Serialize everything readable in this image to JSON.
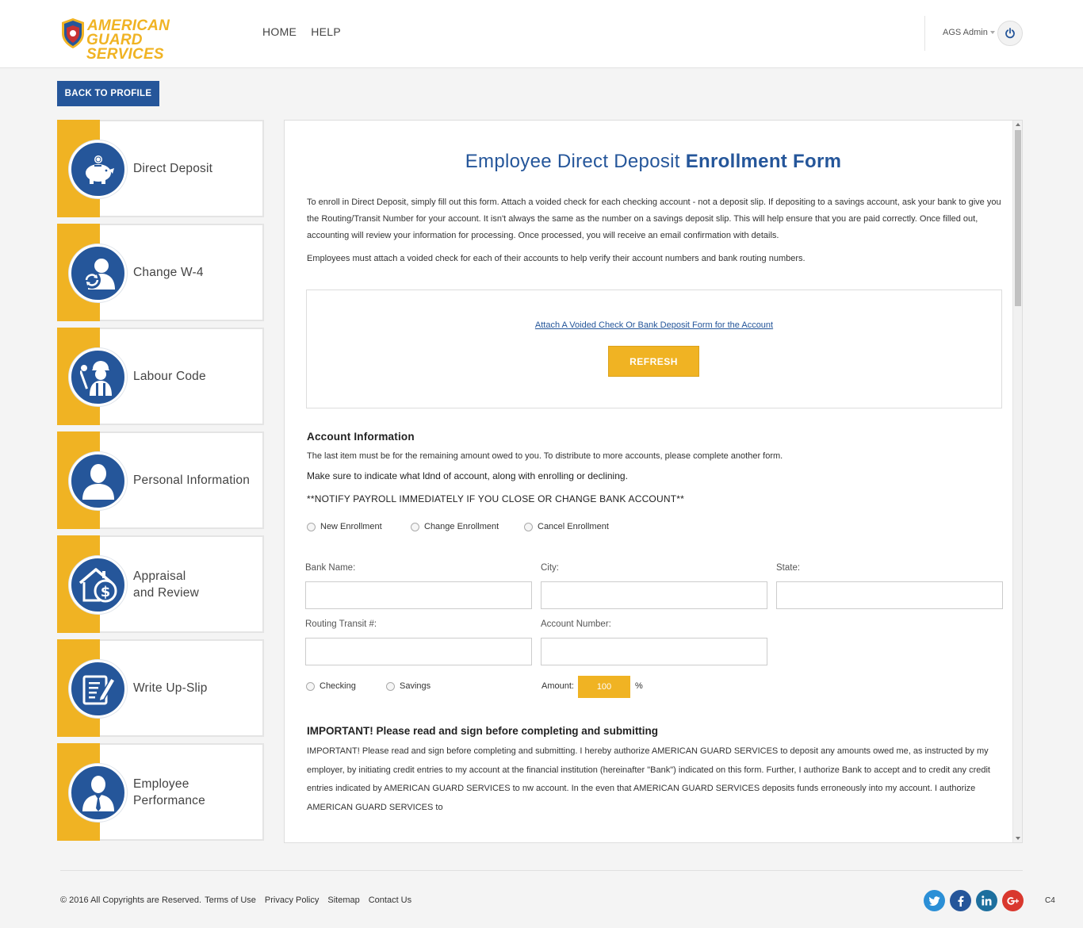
{
  "header": {
    "logo_line1": "AMERICAN",
    "logo_line2": "GUARD SERVICES",
    "nav": [
      "HOME",
      "HELP"
    ],
    "user_name": "AGS Admin",
    "power_icon": "power-icon"
  },
  "back_button": "BACK TO PROFILE",
  "sidebar": {
    "items": [
      {
        "label": "Direct Deposit",
        "icon": "piggy-bank-icon"
      },
      {
        "label": "Change W-4",
        "icon": "user-refresh-icon"
      },
      {
        "label": "Labour Code",
        "icon": "worker-icon"
      },
      {
        "label": "Personal Information",
        "icon": "user-icon"
      },
      {
        "label_line1": "Appraisal",
        "label_line2": "and Review",
        "icon": "house-dollar-icon"
      },
      {
        "label": "Write Up-Slip",
        "icon": "document-edit-icon"
      },
      {
        "label_line1": "Employee",
        "label_line2": "Performance",
        "icon": "businessman-icon"
      }
    ]
  },
  "form": {
    "title_light": "Employee Direct Deposit ",
    "title_bold": "Enrollment Form",
    "intro": "To enroll in Direct Deposit, simply fill out this form. Attach a voided check for each checking account - not a deposit slip. If depositing to a savings account, ask your bank to give you the Routing/Transit Number for your account. It isn't always the same as the number on a savings deposit slip. This will help ensure that you are paid correctly. Once filled out, accounting will review your information for processing. Once processed, you will receive an email confirmation with details.",
    "intro2": "Employees must attach a voided check for each of their accounts to help verify their account numbers and bank routing numbers.",
    "attach_link": "Attach A Voided Check Or Bank Deposit Form for the Account",
    "refresh": "REFRESH",
    "account_title": "Account Information",
    "account_desc": "The last item must be for the remaining amount owed to you. To distribute to more accounts, please complete another form.",
    "account_note": "Make sure to indicate what ldnd of account, along with enrolling or declining.",
    "account_notify": "**NOTIFY PAYROLL IMMEDIATELY IF YOU CLOSE OR CHANGE BANK ACCOUNT**",
    "enrollment_options": [
      "New Enrollment",
      "Change Enrollment",
      "Cancel Enrollment"
    ],
    "fields": {
      "bank_name": "Bank Name:",
      "city": "City:",
      "state": "State:",
      "routing": "Routing Transit #:",
      "account_number": "Account Number:"
    },
    "account_types": [
      "Checking",
      "Savings"
    ],
    "amount_label": "Amount:",
    "amount_value": "100",
    "amount_unit": "%",
    "important_title": "IMPORTANT! Please read and sign before completing and submitting",
    "important_text": "IMPORTANT! Please read and sign before completing and submitting. I hereby authorize AMERICAN GUARD SERVICES to deposit any amounts owed me, as instructed by my employer, by initiating credit entries to my account at the financial institution (hereinafter \"Bank\") indicated on this form. Further, I authorize Bank to accept and to credit any credit entries indicated by AMERICAN GUARD SERVICES to nw account. In the even that AMERICAN GUARD SERVICES deposits funds erroneously into my account. I authorize AMERICAN GUARD SERVICES to"
  },
  "footer": {
    "copyright": "© 2016 All Copyrights are Reserved.",
    "links": [
      "Terms of Use",
      "Privacy Policy",
      "Sitemap",
      "Contact Us"
    ],
    "social": [
      {
        "name": "twitter-icon",
        "color": "#2b8fd6"
      },
      {
        "name": "facebook-icon",
        "color": "#25569a"
      },
      {
        "name": "linkedin-icon",
        "color": "#1d6f9e"
      },
      {
        "name": "google-plus-icon",
        "color": "#d9382e"
      }
    ],
    "build": "C4"
  },
  "colors": {
    "accent": "#f0b323",
    "primary": "#25569a"
  }
}
